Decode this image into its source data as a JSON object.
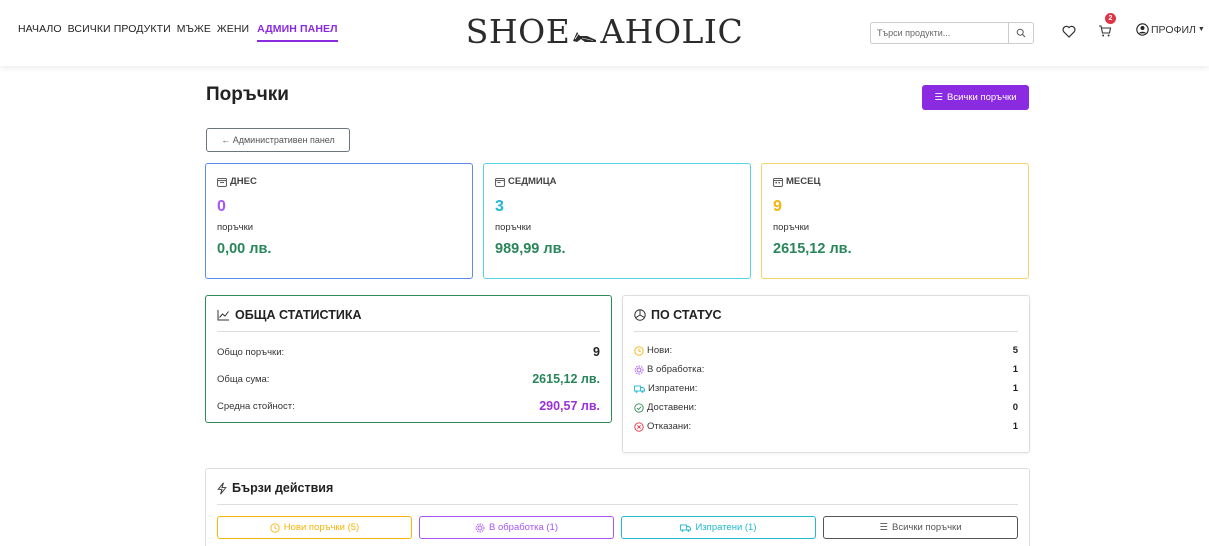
{
  "nav": {
    "links": [
      "НАЧАЛО",
      "ВСИЧКИ ПРОДУКТИ",
      "МЪЖЕ",
      "ЖЕНИ",
      "АДМИН ПАНЕЛ"
    ],
    "active_index": 4,
    "logo_left": "SHOE",
    "logo_right": "AHOLIC",
    "search_placeholder": "Търси продукти...",
    "cart_count": "2",
    "profile_label": "ПРОФИЛ"
  },
  "page": {
    "title": "Поръчки",
    "all_orders_button": "Всички поръчки",
    "back_button": "← Административен панел"
  },
  "cards": [
    {
      "label": "ДНЕС",
      "count": "0",
      "sub": "поръчки",
      "amount": "0,00 лв.",
      "color": "#a855f7",
      "border": "#5b8def",
      "icon": "calendar-day-icon"
    },
    {
      "label": "СЕДМИЦА",
      "count": "3",
      "sub": "поръчки",
      "amount": "989,99 лв.",
      "color": "#22b8cf",
      "border": "#58d3e6",
      "icon": "calendar-week-icon"
    },
    {
      "label": "МЕСЕЦ",
      "count": "9",
      "sub": "поръчки",
      "amount": "2615,12 лв.",
      "color": "#f5b50a",
      "border": "#f3d36b",
      "icon": "calendar-month-icon"
    }
  ],
  "general": {
    "title": "ОБЩА СТАТИСТИКА",
    "rows": [
      {
        "label": "Общо поръчки:",
        "value": "9",
        "color": "#222222"
      },
      {
        "label": "Обща сума:",
        "value": "2615,12 лв.",
        "color": "#28865a"
      },
      {
        "label": "Средна стойност:",
        "value": "290,57 лв.",
        "color": "#9b30d9"
      }
    ],
    "border": "#2e8b57"
  },
  "by_status": {
    "title": "ПО СТАТУС",
    "rows": [
      {
        "label": "Нови:",
        "value": "5",
        "icon": "clock-icon",
        "color": "#f5b50a"
      },
      {
        "label": "В обработка:",
        "value": "1",
        "icon": "gear-icon",
        "color": "#a855f7"
      },
      {
        "label": "Изпратени:",
        "value": "1",
        "icon": "truck-icon",
        "color": "#22b8cf"
      },
      {
        "label": "Доставени:",
        "value": "0",
        "icon": "check-circle-icon",
        "color": "#2e8b57"
      },
      {
        "label": "Отказани:",
        "value": "1",
        "icon": "x-circle-icon",
        "color": "#dc3545"
      }
    ]
  },
  "quick_actions": {
    "title": "Бързи действия",
    "buttons": [
      {
        "label": "Нови поръчки (5)",
        "color": "#f5b50a",
        "icon": "clock-icon"
      },
      {
        "label": "В обработка (1)",
        "color": "#a855f7",
        "icon": "gear-icon"
      },
      {
        "label": "Изпратени (1)",
        "color": "#22b8cf",
        "icon": "truck-icon"
      },
      {
        "label": "Всички поръчки",
        "color": "#555555",
        "icon": "list-icon"
      }
    ]
  }
}
